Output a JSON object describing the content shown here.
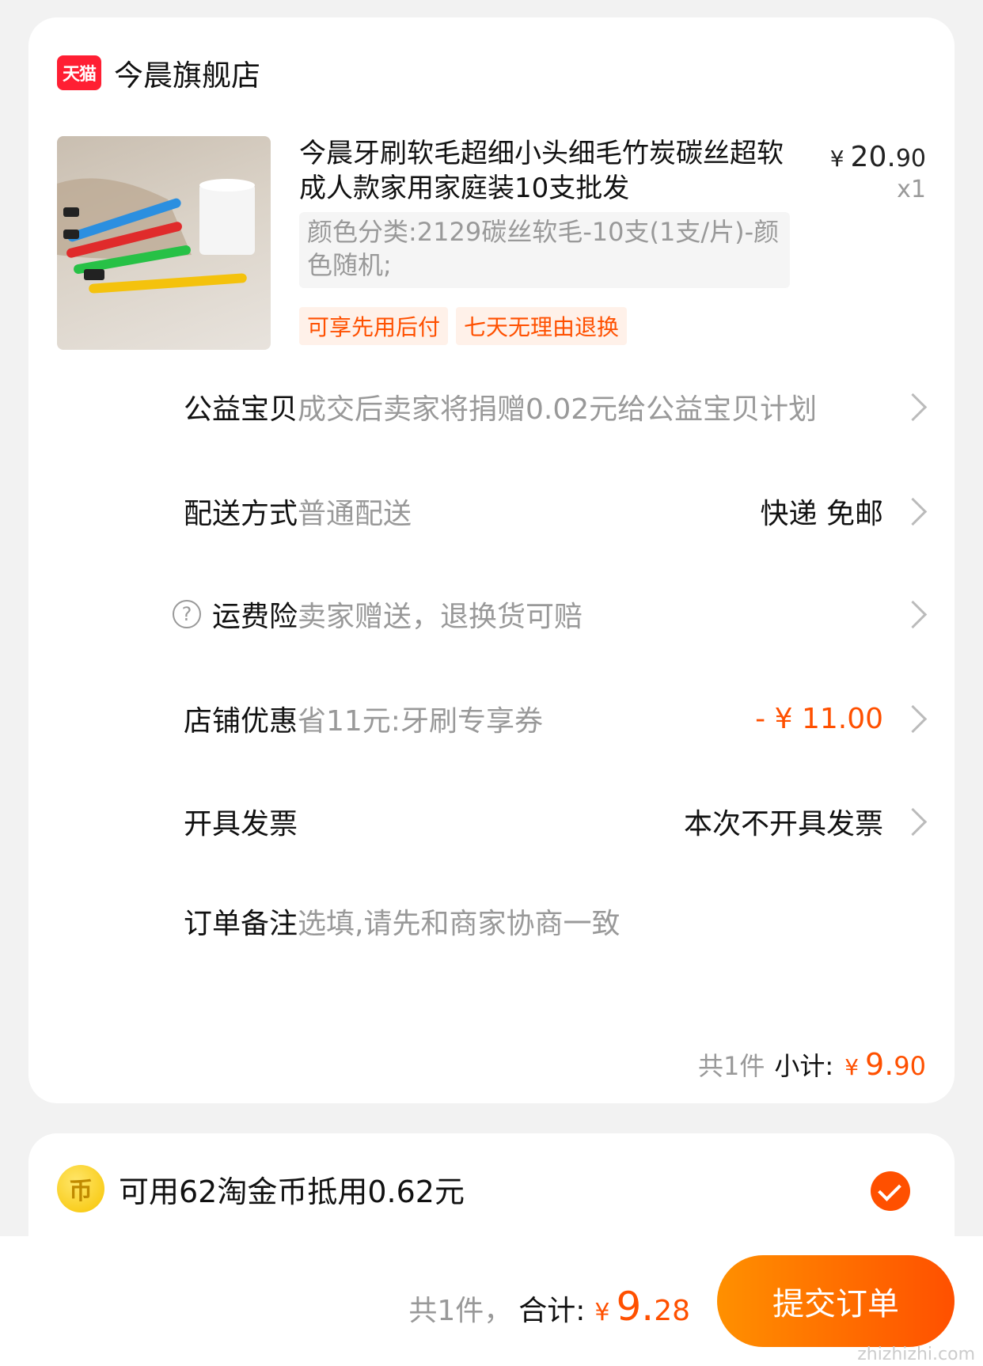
{
  "store": {
    "badge": "天猫",
    "name": "今晨旗舰店"
  },
  "product": {
    "title": "今晨牙刷软毛超细小头细毛竹炭碳丝超软成人款家用家庭装10支批发",
    "price_currency": "¥",
    "price_int": "20.",
    "price_dec": "90",
    "quantity": "x1",
    "sku": "颜色分类:2129碳丝软毛-10支(1支/片)-颜色随机;",
    "tags": [
      "可享先用后付",
      "七天无理由退换"
    ]
  },
  "rows": {
    "charity": {
      "label": "公益宝贝",
      "value": "成交后卖家将捐赠0.02元给公益宝贝计划"
    },
    "delivery": {
      "label": "配送方式",
      "value": "普通配送",
      "right": "快递 免邮"
    },
    "insurance": {
      "label": "运费险",
      "value": "卖家赠送，退换货可赔"
    },
    "discount": {
      "label": "店铺优惠",
      "value": "省11元:牙刷专享券",
      "right": "- ¥ 11.00"
    },
    "invoice": {
      "label": "开具发票",
      "right": "本次不开具发票"
    },
    "note": {
      "label": "订单备注",
      "placeholder": "选填,请先和商家协商一致"
    }
  },
  "subtotal": {
    "count": "共1件",
    "label": "小计:",
    "currency": "¥",
    "int": "9.",
    "dec": "90"
  },
  "coins": {
    "icon_glyph": "币",
    "text": "可用62淘金币抵用0.62元",
    "checked": true
  },
  "footer": {
    "count": "共1件，",
    "label": "合计:",
    "currency": "¥",
    "int": "9.",
    "dec": "28",
    "submit_label": "提交订单"
  },
  "watermark": "zhizhizhi.com",
  "colors": {
    "accent": "#ff5000",
    "tmall_red": "#ff1f33"
  }
}
